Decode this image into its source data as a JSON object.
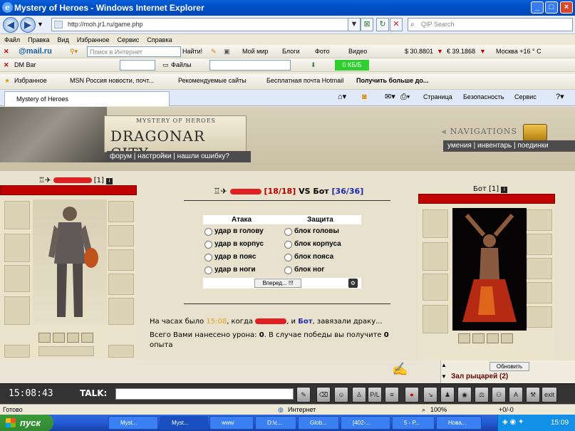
{
  "window": {
    "title": "Mystery of Heroes - Windows Internet Explorer"
  },
  "address": {
    "url": "http://moh.jr1.ru/game.php",
    "search_placeholder": "QIP Search"
  },
  "menu": [
    "Файл",
    "Правка",
    "Вид",
    "Избранное",
    "Сервис",
    "Справка"
  ],
  "mailru_toolbar": {
    "logo": "@mail.ru",
    "search_placeholder": "Поиск в Интернет",
    "find_label": "Найти!",
    "items": [
      "Мой мир",
      "Блоги",
      "Фото",
      "Видео"
    ],
    "usd": "$ 30.8801",
    "eur": "€ 39.1868",
    "weather": "Москва +16 ° С"
  },
  "dm_toolbar": {
    "label": "DM Bar",
    "files_label": "Файлы",
    "speed": "0 КБ/Б"
  },
  "favorites_bar": {
    "favorites": "Избранное",
    "items": [
      "MSN Россия новости, почт...",
      "Рекомендуемые сайты",
      "Бесплатная почта Hotmail",
      "Получить больше до..."
    ]
  },
  "tab": {
    "title": "Mystery of Heroes"
  },
  "commandbar": {
    "page": "Страница",
    "safety": "Безопасность",
    "service": "Сервис"
  },
  "game": {
    "logo_sub": "MYSTERY OF HEROES",
    "logo_main": "DRAGONAR CITY",
    "menu": [
      "форум",
      "настройки",
      "нашли ошибку?"
    ],
    "nav_title": "NAVIGATIONS",
    "nav_menu": [
      "умения",
      "инвентарь",
      "поединки"
    ],
    "player": {
      "level": "[1]"
    },
    "bot": {
      "name": "Бот",
      "level": "[1]"
    },
    "battle": {
      "player_hp": "[18/18]",
      "vs": "VS",
      "bot_name": "Бот",
      "bot_hp": "[36/36]"
    },
    "attack_header": "Атака",
    "defense_header": "Защита",
    "attacks": [
      "удар в голову",
      "удар в корпус",
      "удар в пояс",
      "удар в ноги"
    ],
    "defenses": [
      "блок головы",
      "блок корпуса",
      "блок пояса",
      "блок ног"
    ],
    "forward_button": "Вперед... !!!",
    "log_line1_pre": "На часах было",
    "log_time": "15:08",
    "log_line1_mid": ", когда",
    "log_line1_and": ", и",
    "log_line1_bot": "Бот",
    "log_line1_post": ", завязали драку...",
    "log_line2": "Всего Вами нанесено урона:",
    "damage": "0",
    "log_line2b": ". В случае победы вы получите",
    "exp": "0",
    "log_line3": "опыта",
    "refresh_button": "Обновить",
    "hall": "Зал рыцарей (2)",
    "clock": "15:08:43",
    "talk_label": "TALK:",
    "tool_labels": [
      "P/L",
      "A",
      "exit"
    ]
  },
  "status": {
    "left": "Готово",
    "zone": "Интернет",
    "zoom": "100%",
    "extra": "+0/-0"
  },
  "taskbar": {
    "start": "пуск",
    "tasks": [
      "Myst...",
      "Myst...",
      "www",
      "D:\\с...",
      "Glob...",
      "[402-...",
      "5 - Р...",
      "Нова..."
    ],
    "time": "15:09"
  },
  "colors": {
    "titlebar": "#0054e3",
    "hpbar": "#c10000",
    "taskbar": "#245edb",
    "start": "#3c9a3c"
  }
}
